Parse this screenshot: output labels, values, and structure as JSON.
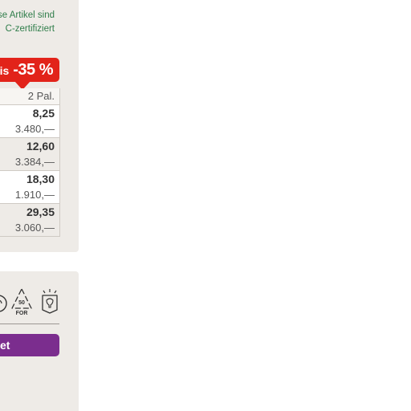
{
  "fsc_note": {
    "line1": "se Artikel sind",
    "line2": "C-zertifiziert"
  },
  "discount_badge": {
    "prefix": "bis",
    "value": "-35 %",
    "color": "#e2231a"
  },
  "price_table": {
    "header": "2 Pal.",
    "rows": [
      {
        "price": "8,25",
        "amount": "3.480,—"
      },
      {
        "price": "12,60",
        "amount": "3.384,—"
      },
      {
        "price": "18,30",
        "amount": "1.910,—"
      },
      {
        "price": "29,35",
        "amount": "3.060,—"
      }
    ]
  },
  "icons": [
    {
      "name": "recycle-circle-icon"
    },
    {
      "name": "recycle-triangle-icon",
      "text_top": "50",
      "text_bottom": "FOR"
    },
    {
      "name": "light-icon"
    }
  ],
  "cta_button": {
    "label": "et",
    "color": "#7b2d8e"
  }
}
